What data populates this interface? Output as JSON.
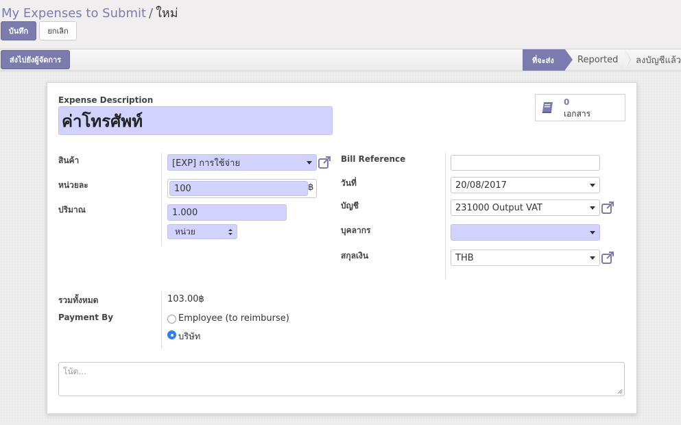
{
  "breadcrumb": {
    "parent": "My Expenses to Submit",
    "separator": "/",
    "current": "ใหม่"
  },
  "toolbar": {
    "save_label": "บันทึก",
    "discard_label": "ยกเลิก"
  },
  "statusbar": {
    "action_label": "ส่งไปยังผู้จัดการ",
    "steps": [
      {
        "label": "ที่จะส่ง",
        "active": true
      },
      {
        "label": "Reported",
        "active": false
      },
      {
        "label": "ลงบัญชีแล้ว",
        "active": false
      }
    ]
  },
  "smart_button": {
    "count": "0",
    "label": "เอกสาร",
    "icon": "book-icon"
  },
  "form": {
    "description_label": "Expense Description",
    "description_value": "ค่าโทรศัพท์",
    "product_label": "สินค้า",
    "product_value": "[EXP] การใช้จ่าย",
    "unit_price_label": "หน่วยละ",
    "unit_price_value": "100",
    "currency_symbol": "฿",
    "quantity_label": "ปริมาณ",
    "quantity_value": "1.000",
    "uom_value": "หน่วย",
    "bill_ref_label": "Bill Reference",
    "bill_ref_value": "",
    "date_label": "วันที่",
    "date_value": "20/08/2017",
    "account_label": "บัญชี",
    "account_value": "231000 Output VAT",
    "employee_label": "บุคลากร",
    "employee_value": "",
    "currency_label": "สกุลเงิน",
    "currency_value": "THB",
    "total_label": "รวมทั้งหมด",
    "total_value": "103.00฿",
    "payment_by_label": "Payment By",
    "payment_options": [
      {
        "label": "Employee (to reimburse)",
        "selected": false
      },
      {
        "label": "บริษัท",
        "selected": true
      }
    ],
    "notes_placeholder": "โน้ต..."
  },
  "colors": {
    "brand": "#7c7bad",
    "required_field": "#d2d2ff",
    "radio_selected": "#2f7ff0"
  }
}
